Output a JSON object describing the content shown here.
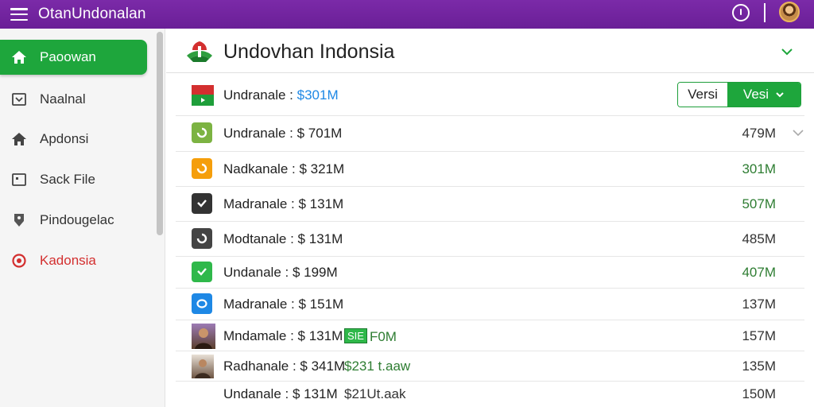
{
  "app": {
    "title": "OtanUndonalan"
  },
  "sidebar": {
    "items": [
      {
        "label": "Paoowan",
        "icon": "home-icon",
        "active": true
      },
      {
        "label": "Naalnal",
        "icon": "inbox-icon"
      },
      {
        "label": "Apdonsi",
        "icon": "house-icon"
      },
      {
        "label": "Sack File",
        "icon": "file-box-icon"
      },
      {
        "label": "Pindougelac",
        "icon": "tag-icon"
      },
      {
        "label": "Kadonsia",
        "icon": "target-icon",
        "alert": true
      }
    ]
  },
  "main": {
    "title": "Undovhan Indonsia",
    "version_toggle": {
      "left_label": "Versi",
      "right_label": "Vesi"
    },
    "rows": [
      {
        "label": "Undranale : ",
        "amount": "$301M",
        "icon": "flag-icon",
        "icon_color": "#ffffff"
      },
      {
        "label": "Undranale : $ 701M",
        "value": "479M",
        "icon": "refresh-icon",
        "icon_color": "#7cb342"
      },
      {
        "label": "Nadkanale : $ 321M",
        "value": "301M",
        "value_green": true,
        "icon": "refresh-icon",
        "icon_color": "#f59e0b"
      },
      {
        "label": "Madranale : $ 131M",
        "value": "507M",
        "value_green": true,
        "icon": "check-icon",
        "icon_color": "#333333"
      },
      {
        "label": "Modtanale : $ 131M",
        "value": "485M",
        "icon": "refresh-icon",
        "icon_color": "#444444"
      },
      {
        "label": "Undanale : $ 199M",
        "value": "407M",
        "value_green": true,
        "icon": "check-icon",
        "icon_color": "#2fb84a"
      },
      {
        "label": "Madranale : $ 151M",
        "value": "137M",
        "icon": "chat-icon",
        "icon_color": "#1e88e5"
      },
      {
        "label": "Mndamale : $ 131M",
        "extra_tag": "SIE",
        "extra": "F0M",
        "value": "157M",
        "icon": "photo-icon",
        "icon_color": "#6d4c41"
      },
      {
        "label": "Radhanale : $ 341M",
        "extra": "$231 t.aaw",
        "value": "135M",
        "icon": "photo-icon",
        "icon_color": "#8d6e63"
      },
      {
        "label": "Undanale : $ 131M",
        "extra": "$21Ut.aak",
        "value": "150M",
        "icon": "",
        "icon_color": "#ffffff"
      }
    ]
  }
}
